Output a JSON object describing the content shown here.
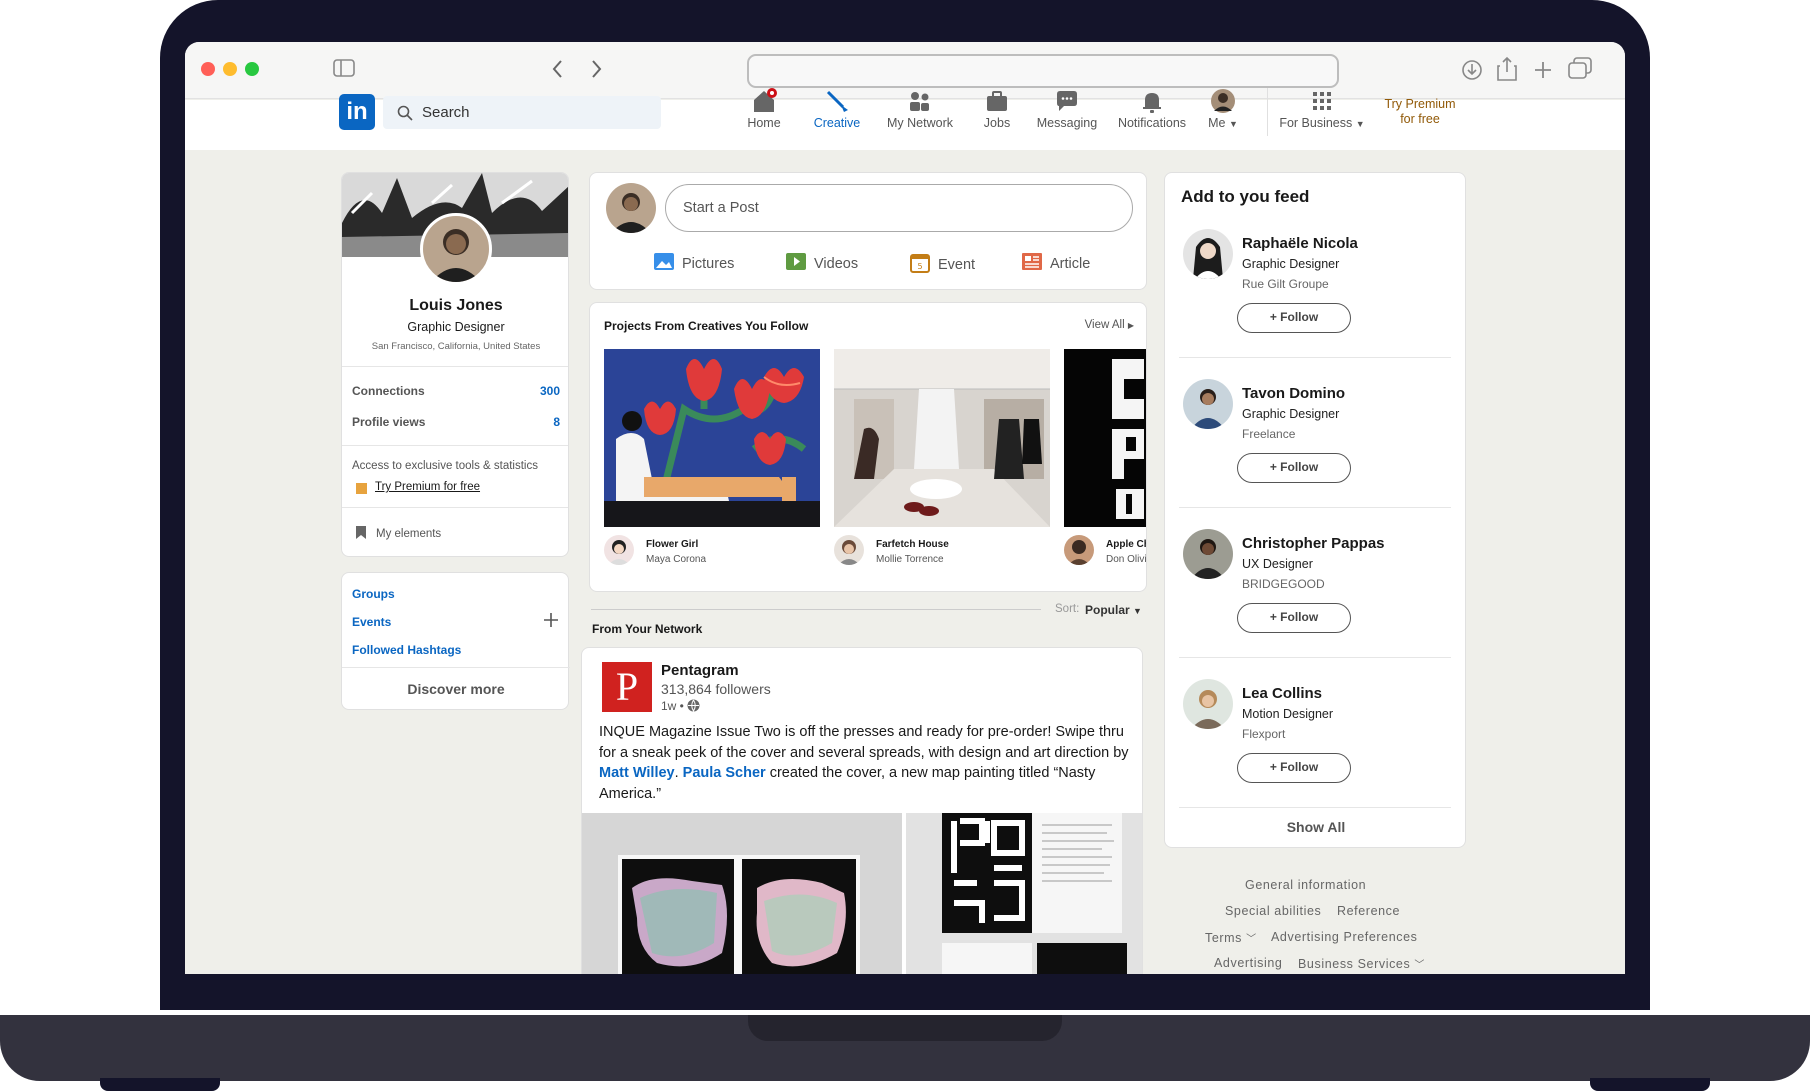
{
  "nav": {
    "search_placeholder": "Search",
    "items": [
      {
        "label": "Home",
        "icon": "home-icon"
      },
      {
        "label": "Creative",
        "icon": "brush-icon"
      },
      {
        "label": "My Network",
        "icon": "network-icon"
      },
      {
        "label": "Jobs",
        "icon": "briefcase-icon"
      },
      {
        "label": "Messaging",
        "icon": "chat-icon"
      },
      {
        "label": "Notifications",
        "icon": "bell-icon"
      },
      {
        "label": "Me",
        "icon": "avatar"
      }
    ],
    "for_business": "For Business",
    "premium_line1": "Try Premium",
    "premium_line2": "for free",
    "accent": "#0a66c2",
    "premium_color": "#915907"
  },
  "profile": {
    "name": "Louis Jones",
    "title": "Graphic Designer",
    "location": "San Francisco, California, United States",
    "connections_label": "Connections",
    "connections_value": "300",
    "views_label": "Profile views",
    "views_value": "8",
    "premium_text": "Access to exclusive tools & statistics",
    "premium_link": "Try Premium for free",
    "my_elements": "My elements"
  },
  "groups": {
    "items": [
      "Groups",
      "Events",
      "Followed Hashtags"
    ],
    "discover": "Discover more"
  },
  "composer": {
    "placeholder": "Start a Post",
    "actions": [
      {
        "label": "Pictures",
        "icon": "picture-icon",
        "color": "#378fe9"
      },
      {
        "label": "Videos",
        "icon": "video-icon",
        "color": "#5f9b41"
      },
      {
        "label": "Event",
        "icon": "calendar-icon",
        "color": "#c37d16"
      },
      {
        "label": "Article",
        "icon": "article-icon",
        "color": "#e06847"
      }
    ]
  },
  "projects": {
    "title": "Projects From Creatives You Follow",
    "view_all": "View All",
    "items": [
      {
        "title": "Flower Girl",
        "author": "Maya Corona"
      },
      {
        "title": "Farfetch House",
        "author": "Mollie Torrence"
      },
      {
        "title": "Apple Ch",
        "author": "Don Olivi"
      }
    ]
  },
  "sort": {
    "label": "Sort:",
    "value": "Popular"
  },
  "network_heading": "From Your Network",
  "post": {
    "author": "Pentagram",
    "followers": "313,864 followers",
    "time": "1w •",
    "text_before": "INQUE Magazine Issue Two is off the presses and ready for pre-order! Swipe thru for a sneak peek of the cover and several spreads, with design and art direction by ",
    "mention1": "Matt Willey",
    "separator": ". ",
    "mention2": "Paula Scher",
    "text_after": " created the cover, a new map painting titled “Nasty America.”"
  },
  "feed": {
    "title": "Add to you feed",
    "follow_label": "+ Follow",
    "people": [
      {
        "name": "Raphaële Nicola",
        "title": "Graphic Designer",
        "company": "Rue Gilt Groupe"
      },
      {
        "name": "Tavon Domino",
        "title": "Graphic Designer",
        "company": "Freelance"
      },
      {
        "name": "Christopher Pappas",
        "title": "UX Designer",
        "company": "BRIDGEGOOD"
      },
      {
        "name": "Lea Collins",
        "title": "Motion Designer",
        "company": "Flexport"
      }
    ],
    "show_all": "Show All"
  },
  "footer": {
    "links": [
      "General information",
      "Special abilities",
      "Reference",
      "Terms",
      "Advertising Preferences",
      "Advertising",
      "Business Services"
    ]
  }
}
